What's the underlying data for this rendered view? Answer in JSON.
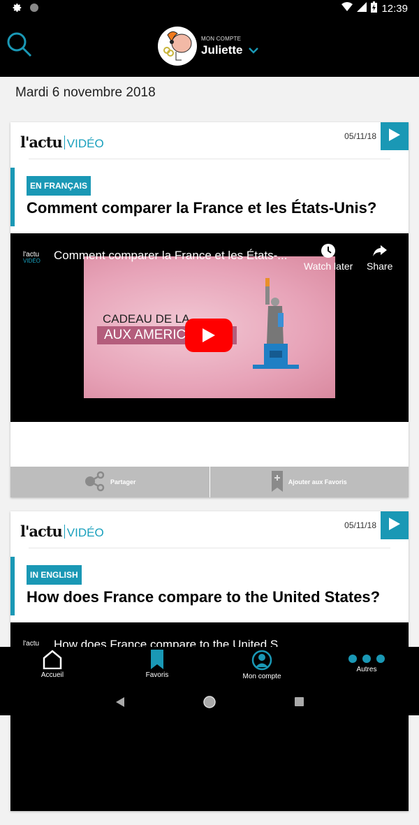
{
  "status_bar": {
    "time": "12:39",
    "left_icons": [
      "gear-icon",
      "circle-icon"
    ],
    "right_icons": [
      "wifi-icon",
      "signal-icon",
      "battery-charging-icon"
    ]
  },
  "app_bar": {
    "search_icon": "search-icon",
    "account_label": "MON COMPTE",
    "account_name": "Juliette"
  },
  "date_header": "Mardi 6 novembre 2018",
  "accent_color": "#1a98b5",
  "cards": [
    {
      "brand": "l'actu",
      "brand_suffix": "VIDÉO",
      "date": "05/11/18",
      "language_badge": "EN FRANÇAIS",
      "title": "Comment comparer la France et les États-Unis?",
      "video": {
        "logo_top": "l'actu",
        "logo_bottom": "VIDÉO",
        "title": "Comment comparer la France et les États-...",
        "watch_later": "Watch later",
        "share": "Share",
        "thumb_line1": "CADEAU DE LA",
        "thumb_line2": "AUX AMERIC"
      },
      "actions": {
        "share": "Partager",
        "favorite": "Ajouter aux Favoris"
      }
    },
    {
      "brand": "l'actu",
      "brand_suffix": "VIDÉO",
      "date": "05/11/18",
      "language_badge": "IN ENGLISH",
      "title": "How does France compare to the United States?",
      "video": {
        "logo_top": "l'actu",
        "title": "How does France compare to the United S..."
      }
    }
  ],
  "bottom_nav": [
    {
      "label": "Accueil",
      "icon": "home-icon"
    },
    {
      "label": "Favoris",
      "icon": "bookmark-icon"
    },
    {
      "label": "Mon compte",
      "icon": "user-circle-icon"
    },
    {
      "label": "Autres",
      "icon": "more-dots-icon"
    }
  ],
  "system_nav": [
    "back-icon",
    "home-circle-icon",
    "recents-icon"
  ]
}
